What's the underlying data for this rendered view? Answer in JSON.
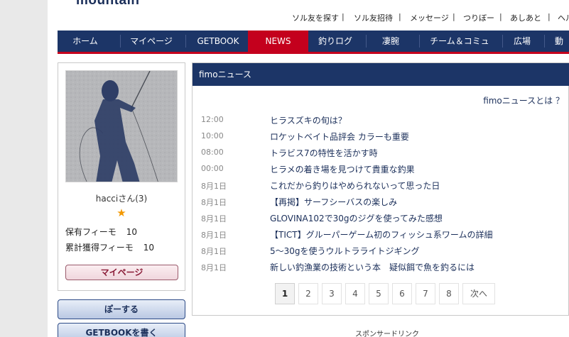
{
  "logo_text": "mountain",
  "util_nav": [
    "ソル友を探す",
    "ソル友招待",
    "メッセージ",
    "つりぼー",
    "あしあと",
    "ヘル"
  ],
  "util_sep": "|",
  "global_nav": [
    {
      "label": "ホーム",
      "active": false
    },
    {
      "label": "マイページ",
      "active": false
    },
    {
      "label": "GETBOOK",
      "active": false
    },
    {
      "label": "NEWS",
      "active": true
    },
    {
      "label": "釣りログ",
      "active": false
    },
    {
      "label": "凄腕",
      "active": false
    },
    {
      "label": "チーム＆コミュ",
      "active": false
    },
    {
      "label": "広場",
      "active": false
    },
    {
      "label": "動",
      "active": false
    }
  ],
  "profile": {
    "name": "hacciさん(3)",
    "star": "★",
    "owned_label": "保有フィーモ",
    "owned_value": "10",
    "total_label": "累計獲得フィーモ",
    "total_value": "10",
    "mypage_button": "マイページ"
  },
  "side_buttons": {
    "post": "ぽーする",
    "getbook": "GETBOOKを書く"
  },
  "news": {
    "heading": "fimoニュース",
    "about_link": "fimoニュースとは ？",
    "items": [
      {
        "time": "12:00",
        "title": "ヒラスズキの旬は？"
      },
      {
        "time": "10:00",
        "title": "ロケットベイト品評会 カラーも重要"
      },
      {
        "time": "08:00",
        "title": "トラビス7の特性を活かす時"
      },
      {
        "time": "00:00",
        "title": "ヒラメの着き場を見つけて貴重な釣果"
      },
      {
        "time": "8月1日",
        "title": "これだから釣りはやめられないって思った日"
      },
      {
        "time": "8月1日",
        "title": "【再掲】サーフシーバスの楽しみ"
      },
      {
        "time": "8月1日",
        "title": "GLOVINA102で30gのジグを使ってみた感想"
      },
      {
        "time": "8月1日",
        "title": "【TICT】グルーパーゲーム初のフィッシュ系ワームの詳細"
      },
      {
        "time": "8月1日",
        "title": "5～30gを使うウルトラライトジギング"
      },
      {
        "time": "8月1日",
        "title": "新しい釣漁業の技術という本　疑似餌で魚を釣るには"
      }
    ],
    "pagination": [
      "1",
      "2",
      "3",
      "4",
      "5",
      "6",
      "7",
      "8"
    ],
    "current_page": "1",
    "next_label": "次へ"
  },
  "sponsor_label": "スポンサードリンク",
  "colors": {
    "nav_bg": "#1c3567",
    "accent_red": "#c4001d",
    "link": "#1b2f5a"
  }
}
